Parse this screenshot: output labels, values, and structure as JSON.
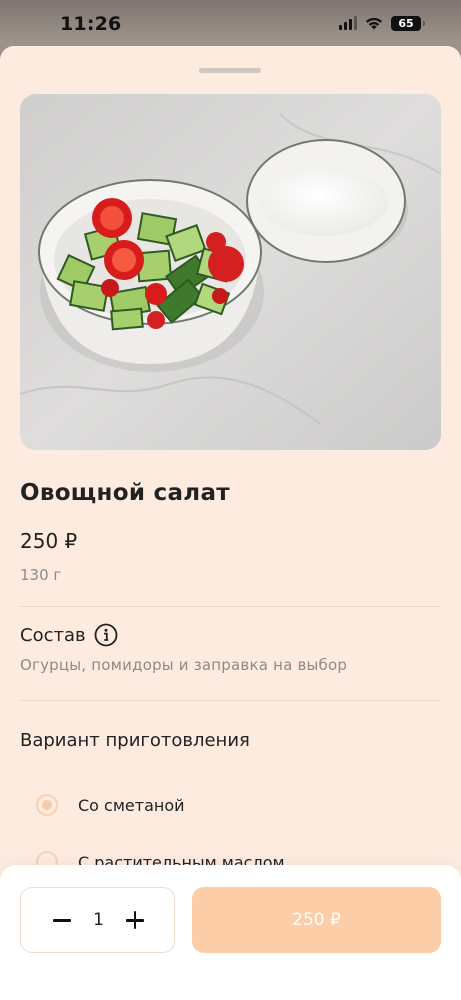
{
  "status_bar": {
    "time": "11:26",
    "battery": "65"
  },
  "product": {
    "title": "Овощной салат",
    "price": "250 ₽",
    "weight": "130 г",
    "image_icon": "salad-photo"
  },
  "composition": {
    "title": "Состав",
    "icon": "info-icon",
    "text": "Огурцы, помидоры и заправка на выбор"
  },
  "variants": {
    "title": "Вариант приготовления",
    "options": [
      {
        "label": "Со сметаной",
        "selected": true
      },
      {
        "label": "С растительным маслом",
        "selected": false
      }
    ]
  },
  "cart": {
    "quantity": "1",
    "add_button_label": "250 ₽"
  },
  "colors": {
    "sheet_background": "#fdebe0",
    "accent": "#fccda6",
    "muted_text": "#8f8a88"
  }
}
